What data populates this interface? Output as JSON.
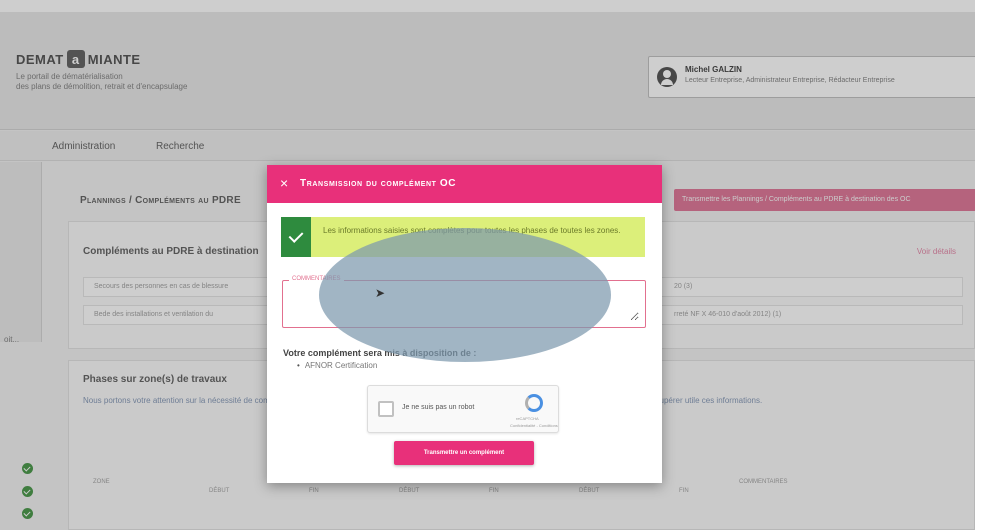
{
  "app": {
    "logo_prefix": "DEMAT",
    "logo_mark": "a",
    "logo_suffix": "MIANTE",
    "tagline_1": "Le portail de dématérialisation",
    "tagline_2": "des plans de démolition, retrait et d'encapsulage"
  },
  "user": {
    "name": "Michel GALZIN",
    "role": "Lecteur Entreprise, Administrateur Entreprise, Rédacteur Entreprise"
  },
  "nav": {
    "items": [
      "Administration",
      "Recherche"
    ]
  },
  "sidebar": {
    "partial_text": "oit..."
  },
  "background": {
    "breadcrumb": "Plannings / Compléments au PDRE",
    "top_action": "Transmettre les Plannings / Compléments au PDRE à destination des OC",
    "complements_title": "Compléments au PDRE à destination",
    "complements_link": "Voir détails",
    "rows": [
      {
        "left": "Secours des personnes en cas de blessure",
        "right": "20 (3)"
      },
      {
        "left": "Bede des installations et ventilation du",
        "right": "rreté NF X 46-010 d'août 2012) (1)"
      }
    ],
    "phases_title": "Phases sur zone(s) de travaux",
    "phases_text": "Nous portons votre attention sur la nécessité de compléter l'ensemble de ces informations dès que possible, afin de permettre aux organismes certificateurs en recupérer utile ces informations.",
    "table_headers": [
      "Zone",
      "Début",
      "Fin",
      "Début",
      "Fin",
      "Début",
      "Fin",
      "Commentaires"
    ]
  },
  "modal": {
    "close_icon": "×",
    "title": "Transmission du complément OC",
    "success_text": "Les informations saisies sont complètes pour toutes les phases de toutes les zones.",
    "comment_label": "Commentaires",
    "comment_value": "",
    "dispo_title": "Votre complément sera mis à disposition de :",
    "dispo_items": [
      "AFNOR Certification"
    ],
    "captcha_label": "Je ne suis pas un robot",
    "captcha_brand": "reCAPTCHA",
    "captcha_terms": "Confidentialité - Conditions",
    "submit_label": "Transmettre un complément"
  },
  "colors": {
    "accent": "#e8307a",
    "success": "#2e8b3e",
    "success_bg": "#dcef7a"
  }
}
